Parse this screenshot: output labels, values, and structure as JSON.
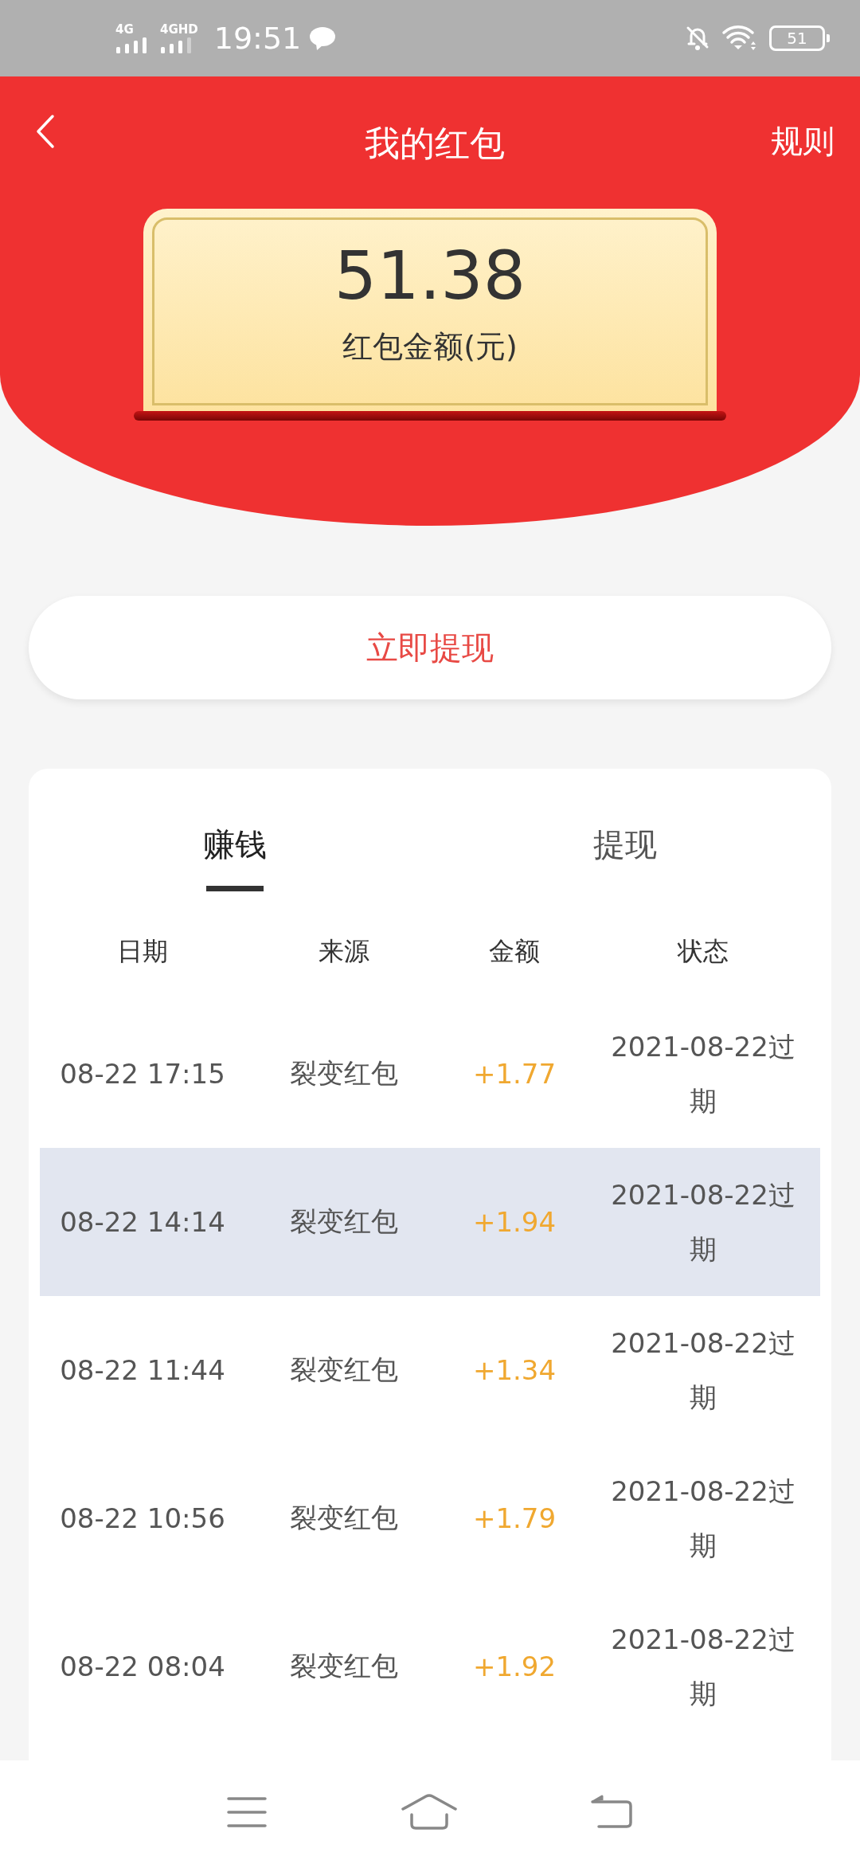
{
  "status_bar": {
    "sim_1": "4G",
    "sim_2": "4GHD",
    "time": "19:51",
    "battery": "51"
  },
  "header": {
    "title": "我的红包",
    "action": "规则"
  },
  "balance": {
    "amount": "51.38",
    "label": "红包金额(元)"
  },
  "withdraw_button": "立即提现",
  "tabs": [
    {
      "label": "赚钱",
      "selected": true
    },
    {
      "label": "提现",
      "selected": false
    }
  ],
  "table": {
    "columns": [
      "日期",
      "来源",
      "金额",
      "状态"
    ],
    "rows": [
      {
        "date": "08-22 17:15",
        "source": "裂变红包",
        "amount": "+1.77",
        "status": "2021-08-22过期",
        "highlighted": false
      },
      {
        "date": "08-22 14:14",
        "source": "裂变红包",
        "amount": "+1.94",
        "status": "2021-08-22过期",
        "highlighted": true
      },
      {
        "date": "08-22 11:44",
        "source": "裂变红包",
        "amount": "+1.34",
        "status": "2021-08-22过期",
        "highlighted": false
      },
      {
        "date": "08-22 10:56",
        "source": "裂变红包",
        "amount": "+1.79",
        "status": "2021-08-22过期",
        "highlighted": false
      },
      {
        "date": "08-22 08:04",
        "source": "裂变红包",
        "amount": "+1.92",
        "status": "2021-08-22过期",
        "highlighted": false
      }
    ]
  }
}
